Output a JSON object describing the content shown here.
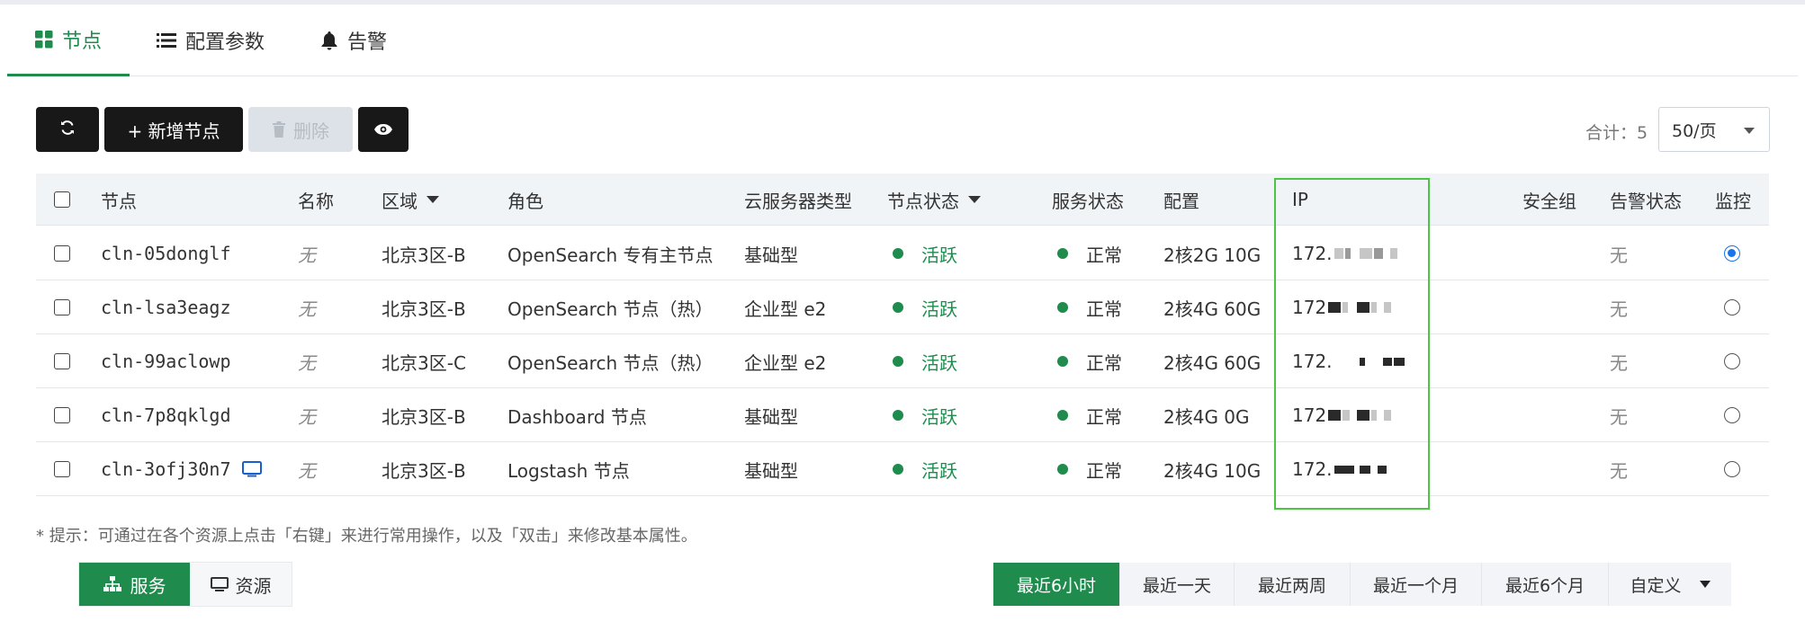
{
  "tabs": [
    {
      "label": "节点",
      "icon": "grid-icon",
      "active": true
    },
    {
      "label": "配置参数",
      "icon": "list-icon",
      "active": false
    },
    {
      "label": "告警",
      "icon": "bell-icon",
      "active": false
    }
  ],
  "toolbar": {
    "refresh_icon": "refresh-icon",
    "add_label": "+ 新增节点",
    "delete_label": "删除",
    "view_icon": "eye-icon",
    "total_label": "合计：5",
    "page_size": "50/页"
  },
  "table": {
    "headers": {
      "node": "节点",
      "name": "名称",
      "region": "区域",
      "role": "角色",
      "server_type": "云服务器类型",
      "node_status": "节点状态",
      "service_status": "服务状态",
      "config": "配置",
      "ip": "IP",
      "security_group": "安全组",
      "alert_status": "告警状态",
      "monitor": "监控"
    },
    "rows": [
      {
        "node": "cln-05donglf",
        "name": "无",
        "region": "北京3区-B",
        "role": "OpenSearch 专有主节点",
        "server_type": "基础型",
        "node_status": "活跃",
        "service_status": "正常",
        "config": "2核2G 10G",
        "ip": "172.",
        "alert": "无",
        "monitor_selected": true,
        "has_monitor_icon": false
      },
      {
        "node": "cln-lsa3eagz",
        "name": "无",
        "region": "北京3区-B",
        "role": "OpenSearch 节点（热）",
        "server_type": "企业型 e2",
        "node_status": "活跃",
        "service_status": "正常",
        "config": "2核4G 60G",
        "ip": "172",
        "alert": "无",
        "monitor_selected": false,
        "has_monitor_icon": false
      },
      {
        "node": "cln-99aclowp",
        "name": "无",
        "region": "北京3区-C",
        "role": "OpenSearch 节点（热）",
        "server_type": "企业型 e2",
        "node_status": "活跃",
        "service_status": "正常",
        "config": "2核4G 60G",
        "ip": "172.",
        "alert": "无",
        "monitor_selected": false,
        "has_monitor_icon": false
      },
      {
        "node": "cln-7p8qklgd",
        "name": "无",
        "region": "北京3区-B",
        "role": "Dashboard 节点",
        "server_type": "基础型",
        "node_status": "活跃",
        "service_status": "正常",
        "config": "2核4G 0G",
        "ip": "172",
        "alert": "无",
        "monitor_selected": false,
        "has_monitor_icon": false
      },
      {
        "node": "cln-3ofj30n7",
        "name": "无",
        "region": "北京3区-B",
        "role": "Logstash 节点",
        "server_type": "基础型",
        "node_status": "活跃",
        "service_status": "正常",
        "config": "2核4G 10G",
        "ip": "172.",
        "alert": "无",
        "monitor_selected": false,
        "has_monitor_icon": true
      }
    ]
  },
  "hint": "* 提示：可通过在各个资源上点击「右键」来进行常用操作，以及「双击」来修改基本属性。",
  "view_toggle": [
    {
      "label": "服务",
      "icon": "sitemap-icon",
      "active": true
    },
    {
      "label": "资源",
      "icon": "monitor-icon",
      "active": false
    }
  ],
  "time_range": [
    {
      "label": "最近6小时",
      "active": true
    },
    {
      "label": "最近一天",
      "active": false
    },
    {
      "label": "最近两周",
      "active": false
    },
    {
      "label": "最近一个月",
      "active": false
    },
    {
      "label": "最近6个月",
      "active": false
    },
    {
      "label": "自定义",
      "active": false
    }
  ],
  "colors": {
    "accent": "#1f8b4d",
    "dark_button": "#181818",
    "highlight_border": "#4cc445",
    "radio_selected": "#1a73e8"
  }
}
